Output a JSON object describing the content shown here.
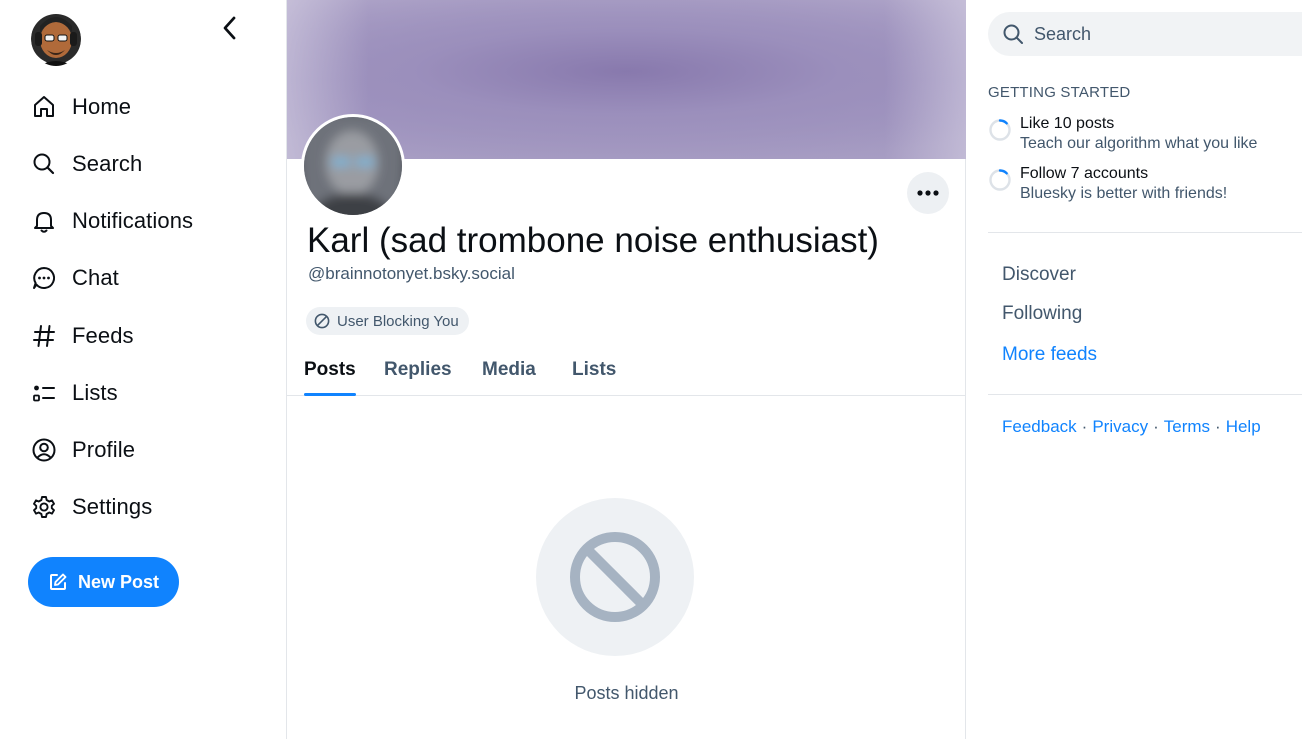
{
  "nav": {
    "items": [
      {
        "label": "Home",
        "icon": "home-icon"
      },
      {
        "label": "Search",
        "icon": "search-icon"
      },
      {
        "label": "Notifications",
        "icon": "bell-icon"
      },
      {
        "label": "Chat",
        "icon": "chat-icon"
      },
      {
        "label": "Feeds",
        "icon": "hash-icon"
      },
      {
        "label": "Lists",
        "icon": "list-icon"
      },
      {
        "label": "Profile",
        "icon": "user-circle-icon"
      },
      {
        "label": "Settings",
        "icon": "gear-icon"
      }
    ],
    "new_post_label": "New Post"
  },
  "profile": {
    "display_name": "Karl (sad trombone noise enthusiast)",
    "handle": "@brainnotonyet.bsky.social",
    "blocking_badge": "User Blocking You",
    "tabs": [
      "Posts",
      "Replies",
      "Media",
      "Lists"
    ],
    "active_tab": "Posts",
    "hidden_message": "Posts hidden"
  },
  "right": {
    "search_placeholder": "Search",
    "getting_started_title": "GETTING STARTED",
    "tasks": [
      {
        "title": "Like 10 posts",
        "subtitle": "Teach our algorithm what you like"
      },
      {
        "title": "Follow 7 accounts",
        "subtitle": "Bluesky is better with friends!"
      }
    ],
    "feeds": [
      "Discover",
      "Following",
      "More feeds"
    ],
    "footer": [
      "Feedback",
      "Privacy",
      "Terms",
      "Help"
    ]
  },
  "colors": {
    "accent": "#1083fe",
    "muted_text": "#42576c",
    "border": "#e3e6ea"
  }
}
